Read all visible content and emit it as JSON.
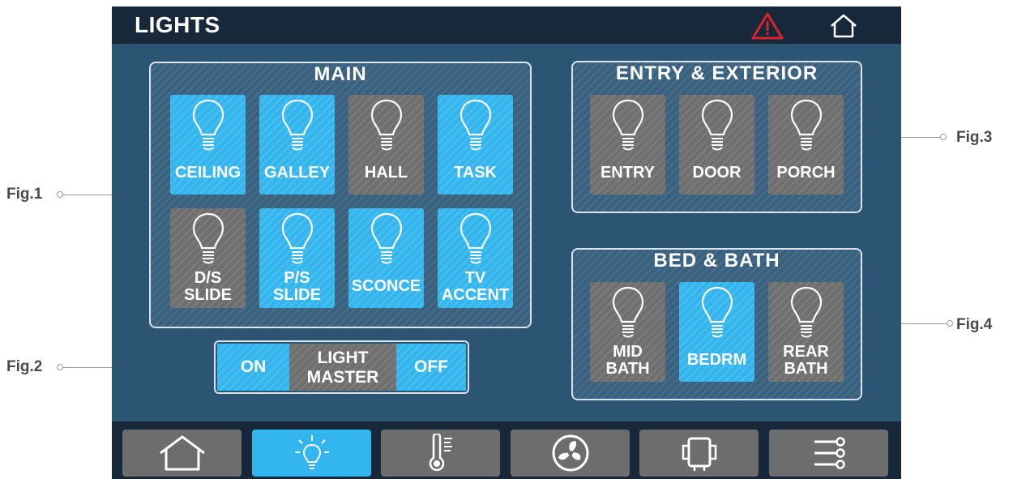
{
  "callouts": {
    "fig1": "Fig.1",
    "fig2": "Fig.2",
    "fig3": "Fig.3",
    "fig4": "Fig.4"
  },
  "header": {
    "title": "LIGHTS",
    "alert_icon": "warning-triangle-icon",
    "home_icon": "home-outline-icon"
  },
  "main_panel": {
    "title": "MAIN",
    "lights": [
      {
        "line1": "CEILING",
        "line2": "",
        "state": "on"
      },
      {
        "line1": "GALLEY",
        "line2": "",
        "state": "on"
      },
      {
        "line1": "HALL",
        "line2": "",
        "state": "off"
      },
      {
        "line1": "TASK",
        "line2": "",
        "state": "on"
      },
      {
        "line1": "D/S",
        "line2": "SLIDE",
        "state": "off"
      },
      {
        "line1": "P/S",
        "line2": "SLIDE",
        "state": "on"
      },
      {
        "line1": "SCONCE",
        "line2": "",
        "state": "on"
      },
      {
        "line1": "TV",
        "line2": "ACCENT",
        "state": "on"
      }
    ]
  },
  "master": {
    "on_label": "ON",
    "title_line1": "LIGHT",
    "title_line2": "MASTER",
    "off_label": "OFF"
  },
  "entry_panel": {
    "title": "ENTRY & EXTERIOR",
    "lights": [
      {
        "line1": "ENTRY",
        "line2": "",
        "state": "off"
      },
      {
        "line1": "DOOR",
        "line2": "",
        "state": "off"
      },
      {
        "line1": "PORCH",
        "line2": "",
        "state": "off"
      }
    ]
  },
  "bed_panel": {
    "title": "BED & BATH",
    "lights": [
      {
        "line1": "MID",
        "line2": "BATH",
        "state": "off"
      },
      {
        "line1": "BEDRM",
        "line2": "",
        "state": "on"
      },
      {
        "line1": "REAR",
        "line2": "BATH",
        "state": "off"
      }
    ]
  },
  "nav": {
    "items": [
      {
        "icon": "home-icon",
        "active": false
      },
      {
        "icon": "light-bulb-icon",
        "active": true
      },
      {
        "icon": "thermometer-icon",
        "active": false
      },
      {
        "icon": "fan-icon",
        "active": false
      },
      {
        "icon": "generator-icon",
        "active": false
      },
      {
        "icon": "settings-sliders-icon",
        "active": false
      }
    ]
  },
  "colors": {
    "active": "#33b5ee",
    "inactive": "#6f6f6f",
    "background": "#2c5473",
    "bar": "#16283a",
    "alert": "#d9232a"
  }
}
